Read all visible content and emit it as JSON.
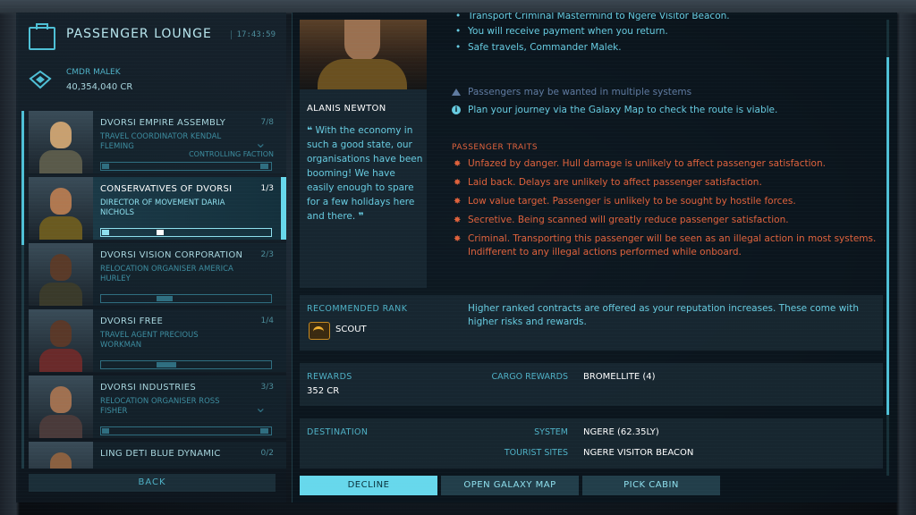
{
  "lounge": {
    "title": "PASSENGER LOUNGE",
    "clock": "17:43:59"
  },
  "commander": {
    "name": "CMDR MALEK",
    "credits": "40,354,040 CR"
  },
  "passengers": [
    {
      "name": "DVORSI EMPIRE ASSEMBLY",
      "count": "7/8",
      "role": "TRAVEL COORDINATOR KENDAL FLEMING",
      "faction": "CONTROLLING FACTION"
    },
    {
      "name": "CONSERVATIVES OF DVORSI",
      "count": "1/3",
      "role": "DIRECTOR OF MOVEMENT DARIA NICHOLS"
    },
    {
      "name": "DVORSI VISION CORPORATION",
      "count": "2/3",
      "role": "RELOCATION ORGANISER AMERICA HURLEY"
    },
    {
      "name": "DVORSI FREE",
      "count": "1/4",
      "role": "TRAVEL AGENT PRECIOUS WORKMAN"
    },
    {
      "name": "DVORSI INDUSTRIES",
      "count": "3/3",
      "role": "RELOCATION ORGANISER ROSS FISHER"
    },
    {
      "name": "LING DETI BLUE DYNAMIC",
      "count": "0/2",
      "role": ""
    }
  ],
  "back_label": "BACK",
  "profile": {
    "name": "ALANIS NEWTON",
    "quote": "With the economy in such a good state, our organisations have been booming! We have easily enough to spare for a few holidays here and there."
  },
  "messages": [
    "Transport Criminal Mastermind to Ngere Visitor Beacon.",
    "You will receive payment when you return.",
    "Safe travels, Commander Malek."
  ],
  "notes": {
    "wanted": "Passengers may be wanted in multiple systems",
    "plan": "Plan your journey via the Galaxy Map to check the route is viable."
  },
  "traits": {
    "header": "PASSENGER TRAITS",
    "items": [
      "Unfazed by danger. Hull damage is unlikely to affect passenger satisfaction.",
      "Laid back. Delays are unlikely to affect passenger satisfaction.",
      "Low value target. Passenger is unlikely to be sought by hostile forces.",
      "Secretive. Being scanned will greatly reduce passenger satisfaction.",
      "Criminal. Transporting this passenger will be seen as an illegal action in most systems. Indifferent to any illegal actions performed while onboard."
    ]
  },
  "rank": {
    "label": "RECOMMENDED RANK",
    "value": "SCOUT",
    "desc": "Higher ranked contracts are offered as your reputation increases. These come with higher risks and rewards."
  },
  "rewards": {
    "label": "REWARDS",
    "credits": "352 CR",
    "cargo_label": "CARGO REWARDS",
    "cargo_value": "BROMELLITE (4)"
  },
  "destination": {
    "label": "DESTINATION",
    "system_label": "SYSTEM",
    "system_value": "NGERE (62.35LY)",
    "sites_label": "TOURIST SITES",
    "sites_value": "NGERE VISITOR BEACON"
  },
  "actions": {
    "decline": "DECLINE",
    "galaxy_map": "OPEN GALAXY MAP",
    "pick_cabin": "PICK CABIN"
  },
  "colors": {
    "accent": "#67d8ec",
    "warning": "#e0623c",
    "text": "#67cbe0",
    "dim_note": "#5f7aa0"
  }
}
